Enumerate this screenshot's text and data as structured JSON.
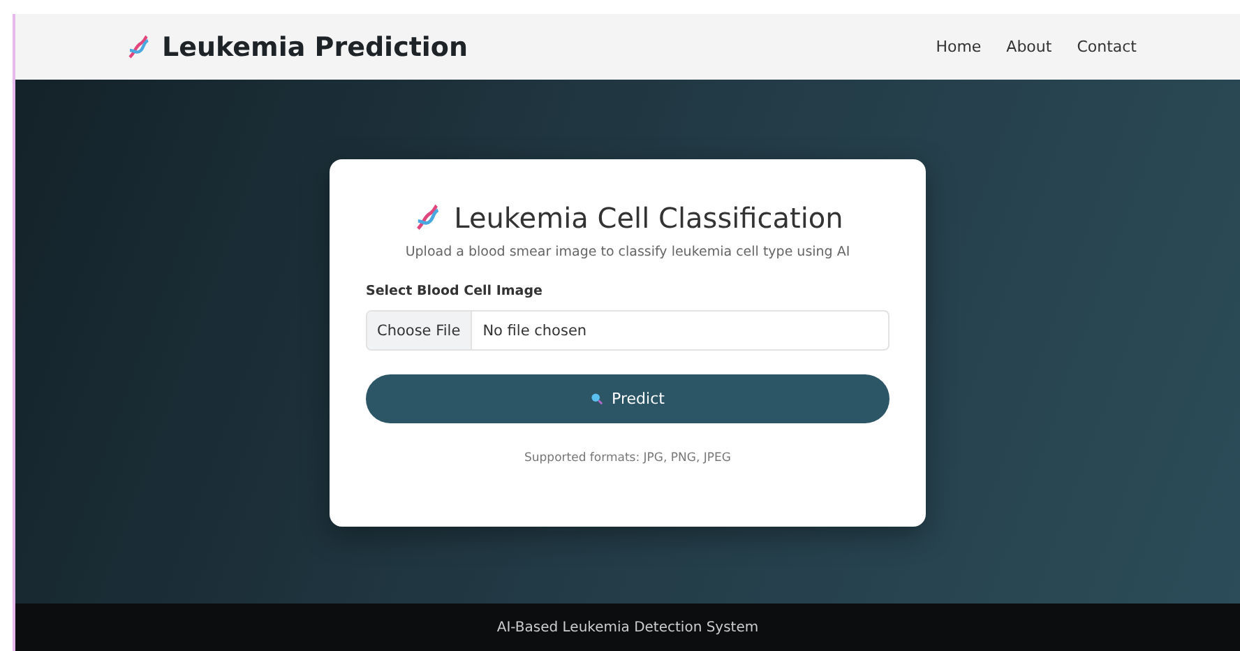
{
  "navbar": {
    "brand": "Leukemia Prediction",
    "links": [
      {
        "label": "Home"
      },
      {
        "label": "About"
      },
      {
        "label": "Contact"
      }
    ]
  },
  "card": {
    "title": "Leukemia Cell Classification",
    "subtitle": "Upload a blood smear image to classify leukemia cell type using AI",
    "field_label": "Select Blood Cell Image",
    "file_button": "Choose File",
    "file_status": "No file chosen",
    "predict_button": "Predict",
    "note": "Supported formats: JPG, PNG, JPEG"
  },
  "footer": {
    "text": "AI-Based Leukemia Detection System"
  }
}
